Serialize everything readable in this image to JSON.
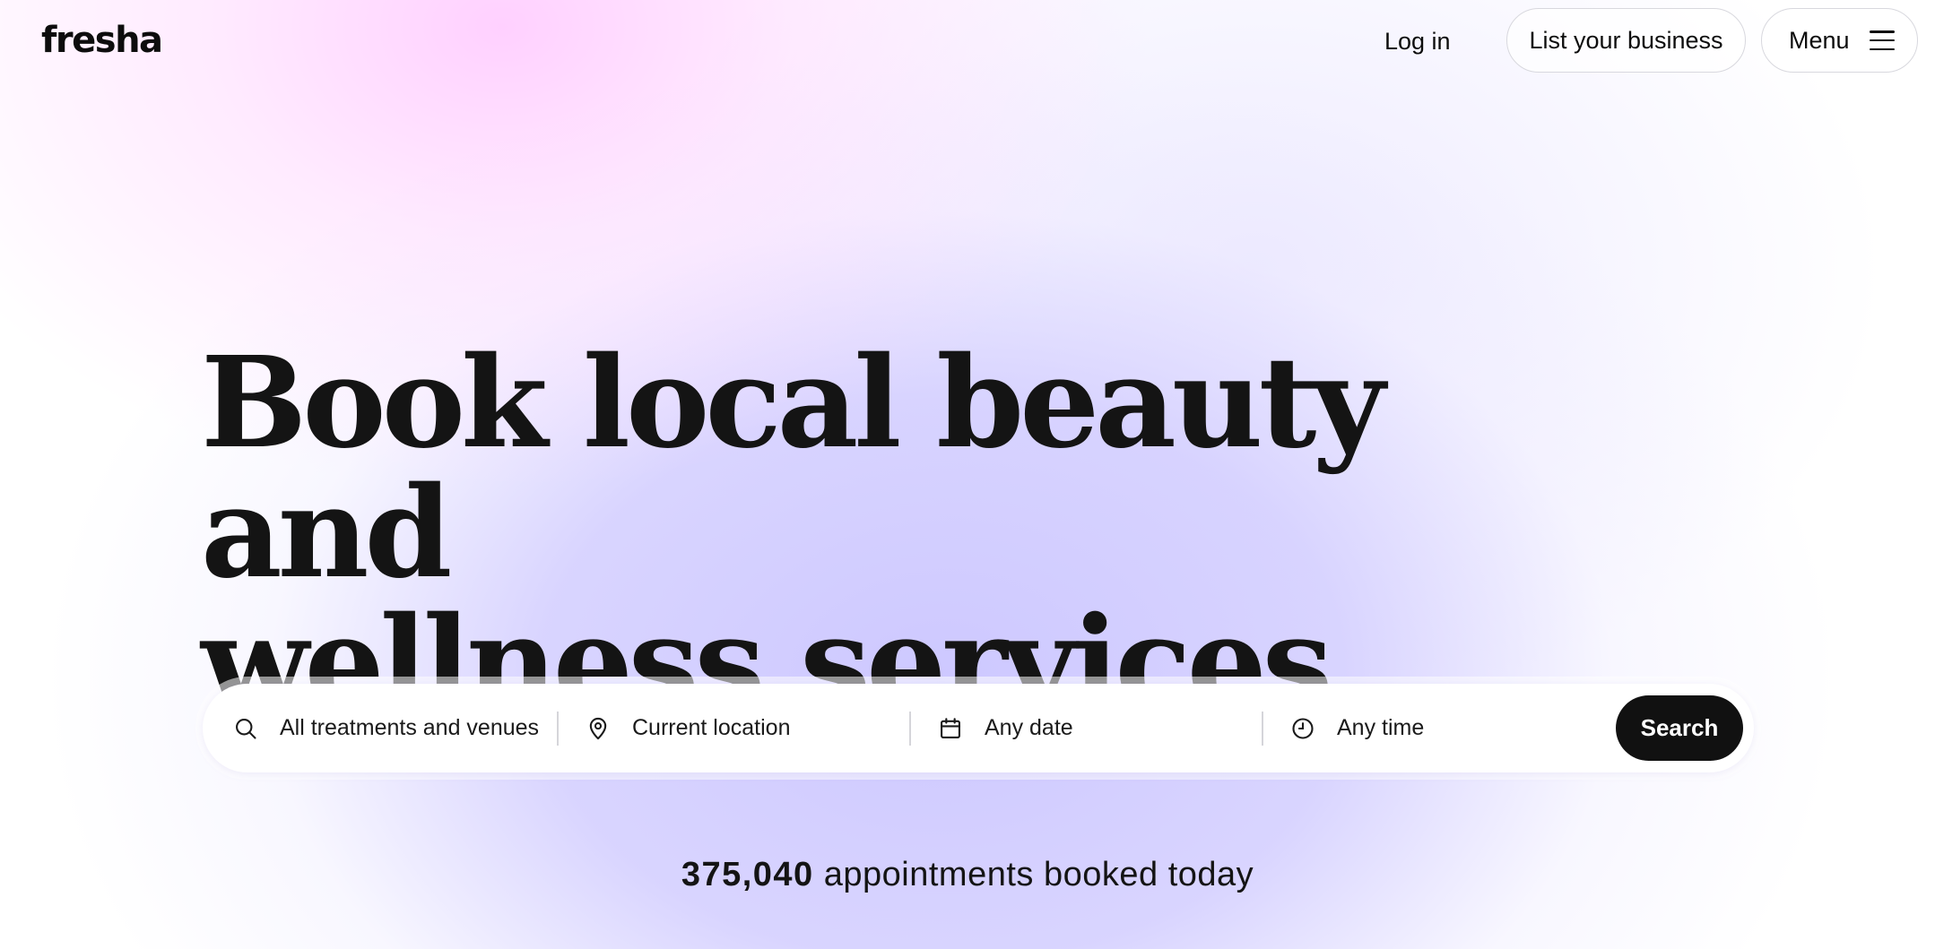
{
  "header": {
    "logo": "fresha",
    "login_label": "Log in",
    "list_business_label": "List your business",
    "menu_label": "Menu"
  },
  "hero": {
    "headline_line1": "Book local beauty and",
    "headline_line2": "wellness services"
  },
  "search": {
    "treatments_placeholder": "All treatments and venues",
    "location_placeholder": "Current location",
    "date_placeholder": "Any date",
    "time_placeholder": "Any time",
    "button_label": "Search",
    "icons": [
      "search-icon",
      "location-pin-icon",
      "calendar-icon",
      "clock-icon"
    ]
  },
  "stats": {
    "count": "375,040",
    "label": "appointments booked today"
  },
  "colors": {
    "text": "#0d0d0d",
    "button_bg": "#111111",
    "accent_purple": "#cdc8ff",
    "accent_pink": "#ffc8ff"
  }
}
